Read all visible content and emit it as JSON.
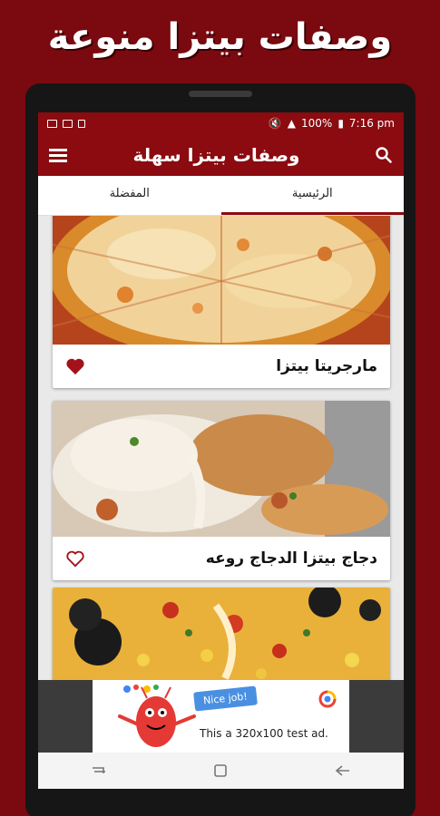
{
  "banner": {
    "title": "وصفات بيتزا منوعة"
  },
  "statusbar": {
    "battery": "100%",
    "time": "7:16 pm"
  },
  "appbar": {
    "title": "وصفات بيتزا سهلة",
    "menu_icon": "hamburger-icon",
    "search_icon": "search-icon"
  },
  "tabs": [
    {
      "label": "المفضلة",
      "active": false
    },
    {
      "label": "الرئيسية",
      "active": true
    }
  ],
  "recipes": [
    {
      "title": "مارجريتا بيتزا",
      "favorited": true
    },
    {
      "title": "دجاج بيتزا الدجاج روعه",
      "favorited": false
    },
    {
      "title": "",
      "favorited": false
    }
  ],
  "ad": {
    "pill": "Nice job!",
    "text": "This a 320x100 test ad."
  },
  "colors": {
    "brand": "#8b0b10",
    "background": "#7a0a0f"
  }
}
